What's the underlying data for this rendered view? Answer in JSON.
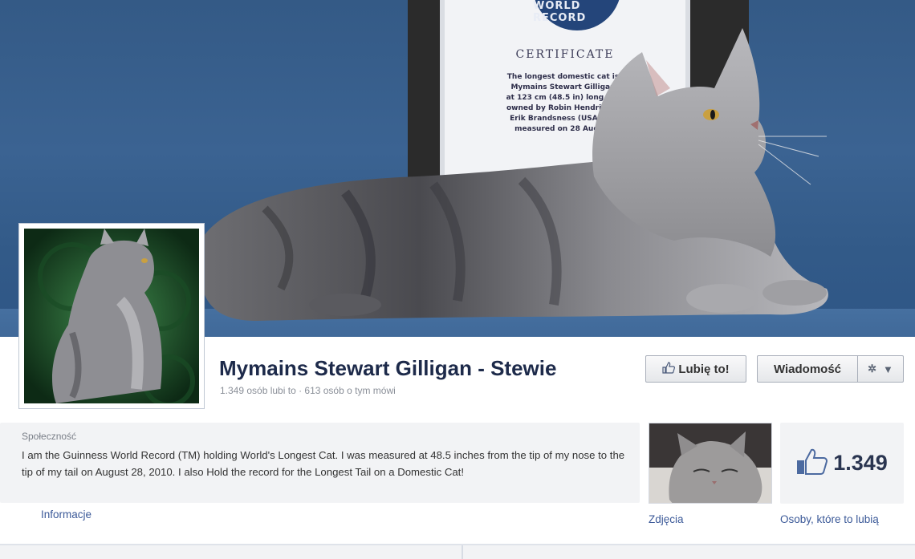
{
  "cover": {
    "certificate": {
      "seal_text": "WORLD RECORD",
      "title": "CERTIFICATE",
      "body": "The longest domestic cat is\nMymains Stewart Gilligan\nat 123 cm (48.5 in) long. He\nowned by Robin Hendrickso\nErik Brandsness (USA), an\nmeasured on 28 August"
    }
  },
  "page": {
    "name": "Mymains Stewart Gilligan - Stewie",
    "stats": "1.349 osób lubi to · 613 osób o tym mówi"
  },
  "actions": {
    "like_label": "Lubię to!",
    "message_label": "Wiadomość"
  },
  "about": {
    "category": "Społeczność",
    "description": "I am the Guinness World Record (TM) holding World's Longest Cat. I was measured at 48.5 inches from the tip of my nose to the tip of my tail on August 28, 2010. I also Hold the record for the Longest Tail on a Domestic Cat!",
    "info_link": "Informacje"
  },
  "photos": {
    "link": "Zdjęcia"
  },
  "likes": {
    "count": "1.349",
    "link": "Osoby, które to lubią"
  },
  "colors": {
    "cover_blue": "#345a86",
    "link_blue": "#3b5998",
    "name_navy": "#1d2a4a"
  },
  "icons": [
    "thumbs-up-icon",
    "gear-icon",
    "chevron-down-icon"
  ]
}
